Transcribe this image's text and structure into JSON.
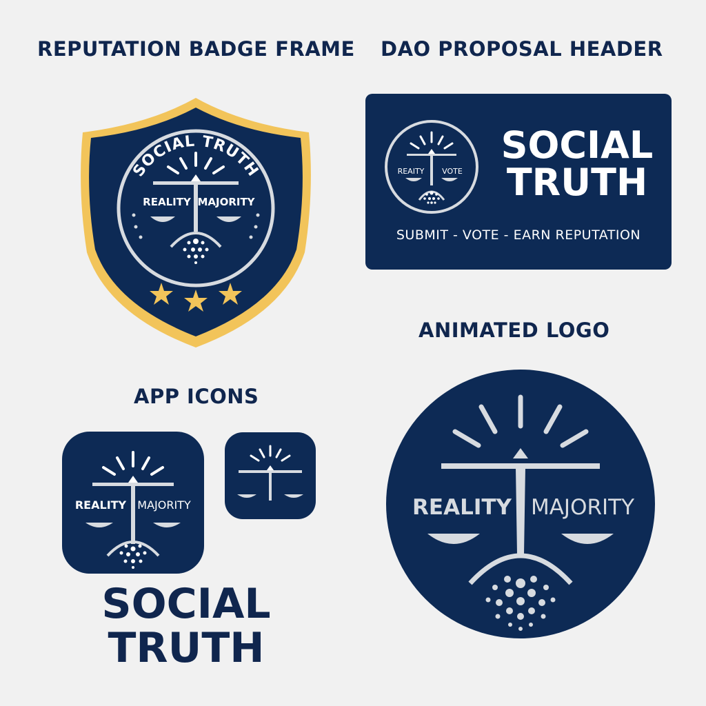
{
  "sections": {
    "badge_title": "REPUTATION BADGE FRAME",
    "dao_title": "DAO PROPOSAL HEADER",
    "animated_title": "ANIMATED LOGO",
    "app_icons_title": "APP ICONS"
  },
  "badge": {
    "arc_text": "SOCIAL TRUTH",
    "left_label": "REALITY",
    "right_label": "MAJORITY",
    "stars": 3
  },
  "dao_header": {
    "name_line1": "SOCIAL",
    "name_line2": "TRUTH",
    "emblem_left": "REAITY",
    "emblem_right": "VOTE",
    "tagline": "SUBMIT - VOTE - EARN REPUTATION"
  },
  "app_icons": {
    "large_left": "REALITY",
    "large_right": "MAJORITY"
  },
  "wordmark": {
    "line1": "SOCIAL",
    "line2": "TRUTH"
  },
  "animated_logo": {
    "left_label": "REALITY",
    "right_label": "MAJORITY"
  },
  "colors": {
    "navy": "#0d2a55",
    "title_navy": "#10264e",
    "gold": "#f2c45a",
    "silver": "#d7dbe0",
    "background": "#f1f1f1"
  },
  "icons": [
    "scales-icon",
    "sun-rays-icon",
    "dot-cluster-icon",
    "star-icon"
  ]
}
